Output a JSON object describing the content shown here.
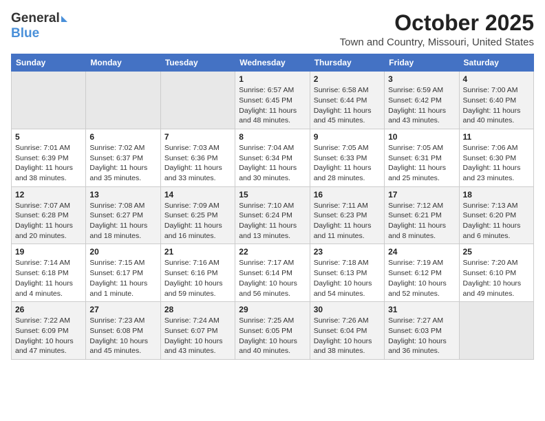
{
  "header": {
    "logo_general": "General",
    "logo_blue": "Blue",
    "title": "October 2025",
    "subtitle": "Town and Country, Missouri, United States"
  },
  "days_of_week": [
    "Sunday",
    "Monday",
    "Tuesday",
    "Wednesday",
    "Thursday",
    "Friday",
    "Saturday"
  ],
  "weeks": [
    [
      {
        "num": "",
        "info": ""
      },
      {
        "num": "",
        "info": ""
      },
      {
        "num": "",
        "info": ""
      },
      {
        "num": "1",
        "info": "Sunrise: 6:57 AM\nSunset: 6:45 PM\nDaylight: 11 hours and 48 minutes."
      },
      {
        "num": "2",
        "info": "Sunrise: 6:58 AM\nSunset: 6:44 PM\nDaylight: 11 hours and 45 minutes."
      },
      {
        "num": "3",
        "info": "Sunrise: 6:59 AM\nSunset: 6:42 PM\nDaylight: 11 hours and 43 minutes."
      },
      {
        "num": "4",
        "info": "Sunrise: 7:00 AM\nSunset: 6:40 PM\nDaylight: 11 hours and 40 minutes."
      }
    ],
    [
      {
        "num": "5",
        "info": "Sunrise: 7:01 AM\nSunset: 6:39 PM\nDaylight: 11 hours and 38 minutes."
      },
      {
        "num": "6",
        "info": "Sunrise: 7:02 AM\nSunset: 6:37 PM\nDaylight: 11 hours and 35 minutes."
      },
      {
        "num": "7",
        "info": "Sunrise: 7:03 AM\nSunset: 6:36 PM\nDaylight: 11 hours and 33 minutes."
      },
      {
        "num": "8",
        "info": "Sunrise: 7:04 AM\nSunset: 6:34 PM\nDaylight: 11 hours and 30 minutes."
      },
      {
        "num": "9",
        "info": "Sunrise: 7:05 AM\nSunset: 6:33 PM\nDaylight: 11 hours and 28 minutes."
      },
      {
        "num": "10",
        "info": "Sunrise: 7:05 AM\nSunset: 6:31 PM\nDaylight: 11 hours and 25 minutes."
      },
      {
        "num": "11",
        "info": "Sunrise: 7:06 AM\nSunset: 6:30 PM\nDaylight: 11 hours and 23 minutes."
      }
    ],
    [
      {
        "num": "12",
        "info": "Sunrise: 7:07 AM\nSunset: 6:28 PM\nDaylight: 11 hours and 20 minutes."
      },
      {
        "num": "13",
        "info": "Sunrise: 7:08 AM\nSunset: 6:27 PM\nDaylight: 11 hours and 18 minutes."
      },
      {
        "num": "14",
        "info": "Sunrise: 7:09 AM\nSunset: 6:25 PM\nDaylight: 11 hours and 16 minutes."
      },
      {
        "num": "15",
        "info": "Sunrise: 7:10 AM\nSunset: 6:24 PM\nDaylight: 11 hours and 13 minutes."
      },
      {
        "num": "16",
        "info": "Sunrise: 7:11 AM\nSunset: 6:23 PM\nDaylight: 11 hours and 11 minutes."
      },
      {
        "num": "17",
        "info": "Sunrise: 7:12 AM\nSunset: 6:21 PM\nDaylight: 11 hours and 8 minutes."
      },
      {
        "num": "18",
        "info": "Sunrise: 7:13 AM\nSunset: 6:20 PM\nDaylight: 11 hours and 6 minutes."
      }
    ],
    [
      {
        "num": "19",
        "info": "Sunrise: 7:14 AM\nSunset: 6:18 PM\nDaylight: 11 hours and 4 minutes."
      },
      {
        "num": "20",
        "info": "Sunrise: 7:15 AM\nSunset: 6:17 PM\nDaylight: 11 hours and 1 minute."
      },
      {
        "num": "21",
        "info": "Sunrise: 7:16 AM\nSunset: 6:16 PM\nDaylight: 10 hours and 59 minutes."
      },
      {
        "num": "22",
        "info": "Sunrise: 7:17 AM\nSunset: 6:14 PM\nDaylight: 10 hours and 56 minutes."
      },
      {
        "num": "23",
        "info": "Sunrise: 7:18 AM\nSunset: 6:13 PM\nDaylight: 10 hours and 54 minutes."
      },
      {
        "num": "24",
        "info": "Sunrise: 7:19 AM\nSunset: 6:12 PM\nDaylight: 10 hours and 52 minutes."
      },
      {
        "num": "25",
        "info": "Sunrise: 7:20 AM\nSunset: 6:10 PM\nDaylight: 10 hours and 49 minutes."
      }
    ],
    [
      {
        "num": "26",
        "info": "Sunrise: 7:22 AM\nSunset: 6:09 PM\nDaylight: 10 hours and 47 minutes."
      },
      {
        "num": "27",
        "info": "Sunrise: 7:23 AM\nSunset: 6:08 PM\nDaylight: 10 hours and 45 minutes."
      },
      {
        "num": "28",
        "info": "Sunrise: 7:24 AM\nSunset: 6:07 PM\nDaylight: 10 hours and 43 minutes."
      },
      {
        "num": "29",
        "info": "Sunrise: 7:25 AM\nSunset: 6:05 PM\nDaylight: 10 hours and 40 minutes."
      },
      {
        "num": "30",
        "info": "Sunrise: 7:26 AM\nSunset: 6:04 PM\nDaylight: 10 hours and 38 minutes."
      },
      {
        "num": "31",
        "info": "Sunrise: 7:27 AM\nSunset: 6:03 PM\nDaylight: 10 hours and 36 minutes."
      },
      {
        "num": "",
        "info": ""
      }
    ]
  ]
}
